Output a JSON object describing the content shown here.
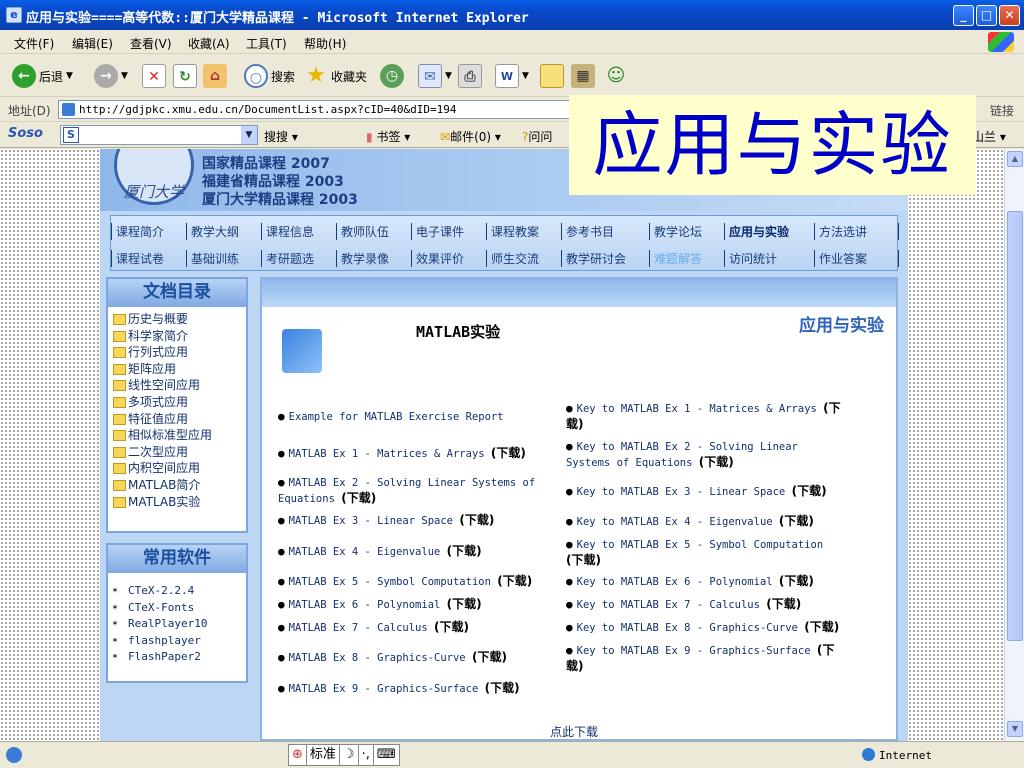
{
  "window": {
    "title": "应用与实验====高等代数::厦门大学精品课程 - Microsoft Internet Explorer",
    "btn_min": "_",
    "btn_max": "□",
    "btn_close": "✕"
  },
  "menu": [
    "文件(F)",
    "编辑(E)",
    "查看(V)",
    "收藏(A)",
    "工具(T)",
    "帮助(H)"
  ],
  "toolbar": {
    "back": "后退",
    "search": "搜索",
    "favorites": "收藏夹"
  },
  "address": {
    "label": "地址(D)",
    "url": "http://gdjpkc.xmu.edu.cn/DocumentList.aspx?cID=40&dID=194",
    "links": "链接"
  },
  "soso": {
    "logo": "Soso",
    "search_btn": "搜搜",
    "bookmarks": "书签",
    "mail": "邮件(0)",
    "ask": "问问",
    "tail": "山兰"
  },
  "banner": {
    "line1": "国家精品课程 2007",
    "line2": "福建省精品课程 2003",
    "line3": "厦门大学精品课程 2003"
  },
  "nav": {
    "row1": [
      "课程简介",
      "教学大纲",
      "课程信息",
      "教师队伍",
      "电子课件",
      "课程教案",
      "参考书目",
      "教学论坛",
      "应用与实验",
      "方法选讲"
    ],
    "row2": [
      "课程试卷",
      "基础训练",
      "考研题选",
      "教学录像",
      "效果评价",
      "师生交流",
      "教学研讨会",
      "难题解答",
      "访问统计",
      "作业答案"
    ]
  },
  "sidebar": {
    "doc_heading": "文档目录",
    "docs": [
      "历史与概要",
      "科学家简介",
      "行列式应用",
      "矩阵应用",
      "线性空间应用",
      "多项式应用",
      "特征值应用",
      "相似标准型应用",
      "二次型应用",
      "内积空间应用",
      "MATLAB简介",
      "MATLAB实验"
    ],
    "sw_heading": "常用软件",
    "software": [
      "CTeX-2.2.4",
      "CTeX-Fonts",
      "RealPlayer10",
      "flashplayer",
      "FlashPaper2"
    ]
  },
  "main": {
    "section": "应用与实验",
    "title": "MATLAB实验",
    "download_label": "(下载)",
    "left": [
      {
        "text": "Example for MATLAB Exercise Report",
        "dl": ""
      },
      {
        "text": "MATLAB Ex 1 - Matrices & Arrays",
        "dl": "(下载)"
      },
      {
        "text": "MATLAB Ex 2 - Solving Linear Systems of Equations",
        "dl": "(下载)"
      },
      {
        "text": "MATLAB Ex 3 - Linear Space",
        "dl": "(下载)"
      },
      {
        "text": "MATLAB Ex 4 - Eigenvalue",
        "dl": "(下载)"
      },
      {
        "text": "MATLAB Ex 5 - Symbol Computation",
        "dl": "(下载)"
      },
      {
        "text": "MATLAB Ex 6 - Polynomial",
        "dl": "(下载)"
      },
      {
        "text": "MATLAB Ex 7 - Calculus",
        "dl": "(下载)"
      },
      {
        "text": "MATLAB Ex 8 - Graphics-Curve",
        "dl": "(下载)"
      },
      {
        "text": "MATLAB Ex 9 - Graphics-Surface",
        "dl": "(下载)"
      }
    ],
    "right": [
      {
        "text": "Key to MATLAB Ex 1 - Matrices & Arrays",
        "dl": "(下载)"
      },
      {
        "text": "Key to MATLAB Ex 2 - Solving Linear Systems of Equations",
        "dl": "(下载)"
      },
      {
        "text": "Key to MATLAB Ex 3 - Linear Space",
        "dl": "(下载)"
      },
      {
        "text": "Key to MATLAB Ex 4 - Eigenvalue",
        "dl": "(下载)"
      },
      {
        "text": "Key to MATLAB Ex 5 - Symbol Computation",
        "dl": "(下载)"
      },
      {
        "text": "Key to MATLAB Ex 6 - Polynomial",
        "dl": "(下载)"
      },
      {
        "text": "Key to MATLAB Ex 7 - Calculus",
        "dl": "(下载)"
      },
      {
        "text": "Key to MATLAB Ex 8 - Graphics-Curve",
        "dl": "(下载)"
      },
      {
        "text": "Key to MATLAB Ex 9 - Graphics-Surface",
        "dl": "(下载)"
      }
    ],
    "download_all": "点此下载"
  },
  "status": {
    "ime_mode": "标准",
    "zone": "Internet"
  },
  "overlay": {
    "title": "应用与实验"
  },
  "icons": {
    "back": "back-arrow-icon",
    "forward": "forward-arrow-icon",
    "stop": "stop-icon",
    "refresh": "refresh-icon",
    "home": "home-icon",
    "search": "search-icon",
    "favorites": "favorites-star-icon",
    "history": "history-icon",
    "mail": "mail-icon",
    "print": "print-icon"
  },
  "colors": {
    "overlay_text": "#0000c8",
    "overlay_bg": "#ffffcc",
    "titlebar": "#0848c8"
  }
}
